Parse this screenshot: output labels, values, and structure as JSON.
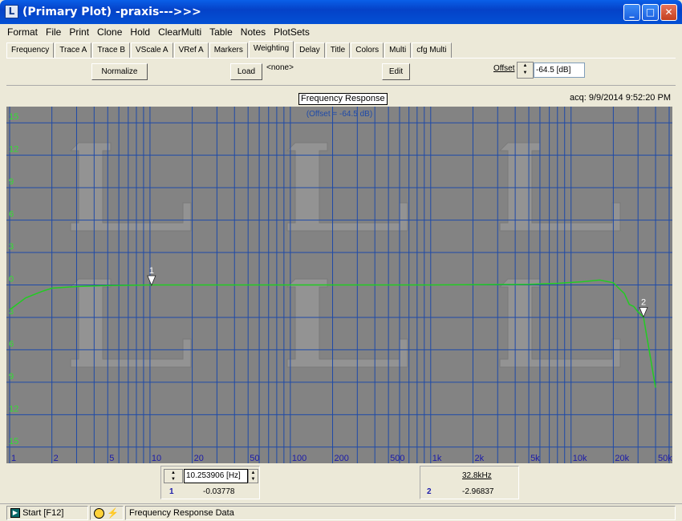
{
  "window": {
    "title": "(Primary Plot) -praxis--->>>",
    "icon": "L"
  },
  "menu": [
    "Format",
    "File",
    "Print",
    "Clone",
    "Hold",
    "ClearMulti",
    "Table",
    "Notes",
    "PlotSets"
  ],
  "tabs": [
    "Frequency",
    "Trace A",
    "Trace B",
    "VScale A",
    "VRef A",
    "Markers",
    "Weighting",
    "Delay",
    "Title",
    "Colors",
    "Multi",
    "cfg Multi"
  ],
  "active_tab": "Weighting",
  "toolbar": {
    "normalize_label": "Normalize",
    "load_label": "Load",
    "loaded_name": "<none>",
    "edit_label": "Edit",
    "offset_label": "Offset",
    "offset_value": "-64.5 [dB]"
  },
  "plot": {
    "title": "Frequency Response",
    "offset_note": "(Offset = -64.5 dB)",
    "acq": "acq: 9/9/2014 9:52:20 PM",
    "colors": {
      "background": "#838383",
      "grid": "#1e4aa8",
      "trace": "#22cc22",
      "ylabel": "#33dd33",
      "xlabel": "#1a1aaa"
    }
  },
  "chart_data": {
    "type": "line",
    "title": "Frequency Response",
    "x_scale": "log",
    "xlim": [
      1,
      50000
    ],
    "ylim": [
      -16.5,
      16.5
    ],
    "y_ticks": [
      15,
      12,
      9,
      6,
      3,
      0,
      -3,
      -6,
      -9,
      -12,
      -15
    ],
    "y_tick_labels": [
      "15",
      "12",
      "9",
      "6",
      "3",
      "0",
      "3",
      "6",
      "9",
      "12",
      "15"
    ],
    "x_tick_labels": [
      {
        "v": 1,
        "t": "1"
      },
      {
        "v": 2,
        "t": "2"
      },
      {
        "v": 5,
        "t": "5"
      },
      {
        "v": 10,
        "t": "10"
      },
      {
        "v": 20,
        "t": "20"
      },
      {
        "v": 50,
        "t": "50"
      },
      {
        "v": 100,
        "t": "100"
      },
      {
        "v": 200,
        "t": "200"
      },
      {
        "v": 500,
        "t": "500"
      },
      {
        "v": 1000,
        "t": "1k"
      },
      {
        "v": 2000,
        "t": "2k"
      },
      {
        "v": 5000,
        "t": "5k"
      },
      {
        "v": 10000,
        "t": "10k"
      },
      {
        "v": 20000,
        "t": "20k"
      },
      {
        "v": 50000,
        "t": "50k"
      }
    ],
    "series": [
      {
        "x": [
          1,
          1.3,
          1.7,
          2,
          3,
          5,
          10,
          50,
          200,
          1000,
          5000,
          8000,
          12000,
          16000,
          20000,
          24000,
          26000,
          28000,
          30000,
          32800,
          36000,
          40000
        ],
        "y": [
          -2.3,
          -1.2,
          -0.6,
          -0.3,
          -0.15,
          -0.05,
          0,
          0,
          0,
          0,
          0.05,
          0.15,
          0.3,
          0.45,
          0.2,
          -0.8,
          -1.8,
          -2.0,
          -2.5,
          -2.97,
          -6.0,
          -9.5
        ]
      }
    ],
    "markers": [
      {
        "label": "1",
        "x": 10.253906,
        "y": -0.03778
      },
      {
        "label": "2",
        "x": 32800,
        "y": -2.96837
      }
    ]
  },
  "cursor1": {
    "freq": "10.253906 [Hz]",
    "index": "1",
    "value": "-0.03778"
  },
  "cursor2": {
    "freq": "32.8kHz",
    "index": "2",
    "value": "-2.96837"
  },
  "status": {
    "start": "Start [F12]",
    "message": "Frequency Response Data"
  }
}
